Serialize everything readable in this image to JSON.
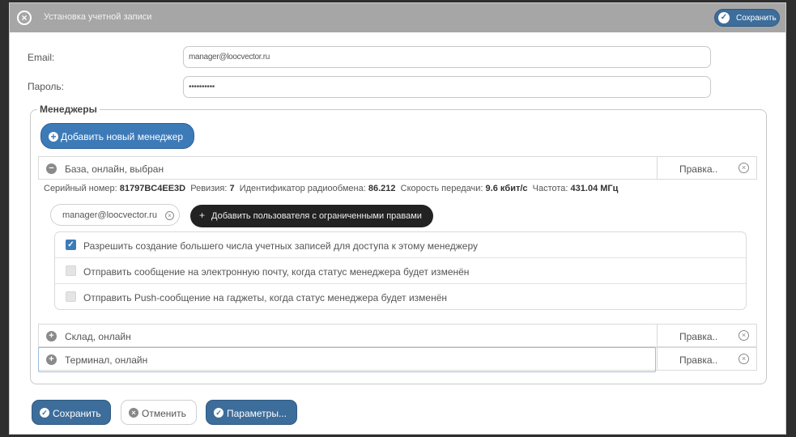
{
  "dialog": {
    "title": "Установка учетной записи",
    "top_save_label": "Сохранить"
  },
  "form": {
    "email_label": "Email:",
    "email_value": "manager@loocvector.ru",
    "password_label": "Пароль:",
    "password_value": "••••••••••"
  },
  "managers": {
    "legend": "Менеджеры",
    "add_button_label": "Добавить новый менеджер",
    "items": [
      {
        "label": "База, онлайн, выбран",
        "edit_label": "Правка..",
        "expanded": true
      },
      {
        "label": "Склад, онлайн",
        "edit_label": "Правка..",
        "expanded": false
      },
      {
        "label": "Терминал, онлайн",
        "edit_label": "Правка..",
        "expanded": false
      }
    ],
    "details": {
      "serial_label": "Серийный номер:",
      "serial_value": "81797BC4EE3D",
      "revision_label": "Ревизия:",
      "revision_value": "7",
      "radio_id_label": "Идентификатор радиообмена:",
      "radio_id_value": "86.212",
      "speed_label": "Скорость передачи:",
      "speed_value": "9.6 кбит/с",
      "freq_label": "Частота:",
      "freq_value": "431.04 МГц",
      "user_tag": "manager@loocvector.ru",
      "add_user_label": "Добавить пользователя с ограниченными правами"
    },
    "options": [
      {
        "label": "Разрешить создание большего числа учетных записей для доступа к этому менеджеру",
        "checked": true
      },
      {
        "label": "Отправить сообщение на электронную почту, когда статус менеджера будет изменён",
        "checked": false
      },
      {
        "label": "Отправить Push-сообщение на гаджеты, когда статус менеджера будет изменён",
        "checked": false
      }
    ]
  },
  "footer": {
    "save_label": "Сохранить",
    "cancel_label": "Отменить",
    "params_label": "Параметры..."
  },
  "colors": {
    "primary": "#3d7ab8",
    "primary_dark": "#3d6d9a",
    "titlebar": "#a6a6a6"
  }
}
